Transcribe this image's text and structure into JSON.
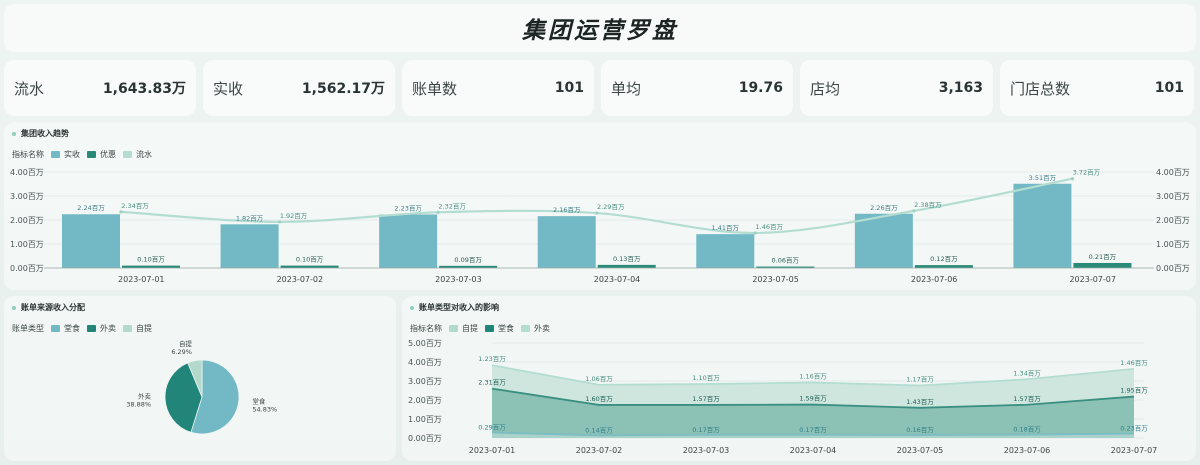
{
  "title": "集团运营罗盘",
  "kpis": [
    {
      "label": "流水",
      "value": "1,643.83万"
    },
    {
      "label": "实收",
      "value": "1,562.17万"
    },
    {
      "label": "账单数",
      "value": "101"
    },
    {
      "label": "单均",
      "value": "19.76"
    },
    {
      "label": "店均",
      "value": "3,163"
    },
    {
      "label": "门店总数",
      "value": "101"
    }
  ],
  "colors": {
    "shishou": "#72b9c5",
    "youhui": "#2a8a78",
    "liushui": "#b4ddd2",
    "tangshi": "#72b9c5",
    "waimai": "#22857a",
    "ziti": "#b2d9cc"
  },
  "trend": {
    "title": "集团收入趋势",
    "legend_label": "指标名称",
    "legend": [
      "实收",
      "优惠",
      "流水"
    ],
    "y_ticks": [
      "4.00百万",
      "3.00百万",
      "2.00百万",
      "1.00百万",
      "0.00百万"
    ],
    "y_ticks_right": [
      "4.00百万",
      "3.00百万",
      "2.00百万",
      "1.00百万",
      "0.00百万"
    ]
  },
  "pie": {
    "title": "账单来源收入分配",
    "legend_label": "账单类型",
    "legend": [
      "堂食",
      "外卖",
      "自提"
    ],
    "labels": [
      {
        "name": "堂食",
        "pct": "54.83%"
      },
      {
        "name": "外卖",
        "pct": "38.88%"
      },
      {
        "name": "自提",
        "pct": "6.29%"
      }
    ]
  },
  "area": {
    "title": "账单类型对收入的影响",
    "legend_label": "指标名称",
    "legend": [
      "自提",
      "堂食",
      "外卖"
    ],
    "y_ticks": [
      "5.00百万",
      "4.00百万",
      "3.00百万",
      "2.00百万",
      "1.00百万",
      "0.00百万"
    ]
  },
  "chart_data": [
    {
      "type": "bar",
      "title": "集团收入趋势",
      "categories": [
        "2023-07-01",
        "2023-07-02",
        "2023-07-03",
        "2023-07-04",
        "2023-07-05",
        "2023-07-06",
        "2023-07-07"
      ],
      "series": [
        {
          "name": "实收",
          "values": [
            2.24,
            1.82,
            2.23,
            2.16,
            1.41,
            2.26,
            3.51
          ],
          "labels": [
            "2.24百万",
            "1.82百万",
            "2.23百万",
            "2.16百万",
            "1.41百万",
            "2.26百万",
            "3.51百万"
          ]
        },
        {
          "name": "优惠",
          "values": [
            0.1,
            0.1,
            0.09,
            0.13,
            0.06,
            0.12,
            0.21
          ],
          "labels": [
            "0.10百万",
            "0.10百万",
            "0.09百万",
            "0.13百万",
            "0.06百万",
            "0.12百万",
            "0.21百万"
          ]
        },
        {
          "name": "流水",
          "type": "line",
          "values": [
            2.34,
            1.92,
            2.32,
            2.29,
            1.46,
            2.38,
            3.72
          ],
          "labels": [
            "2.34百万",
            "1.92百万",
            "2.32百万",
            "2.29百万",
            "1.46百万",
            "2.38百万",
            "3.72百万"
          ]
        }
      ],
      "ylim": [
        0,
        4
      ]
    },
    {
      "type": "pie",
      "title": "账单来源收入分配",
      "categories": [
        "堂食",
        "外卖",
        "自提"
      ],
      "values": [
        54.83,
        38.88,
        6.29
      ]
    },
    {
      "type": "area",
      "title": "账单类型对收入的影响",
      "categories": [
        "2023-07-01",
        "2023-07-02",
        "2023-07-03",
        "2023-07-04",
        "2023-07-05",
        "2023-07-06",
        "2023-07-07"
      ],
      "series": [
        {
          "name": "自提",
          "values": [
            0.29,
            0.14,
            0.17,
            0.17,
            0.16,
            0.18,
            0.23
          ],
          "labels": [
            "0.29百万",
            "0.14百万",
            "0.17百万",
            "0.17百万",
            "0.16百万",
            "0.18百万",
            "0.23百万"
          ]
        },
        {
          "name": "堂食",
          "values": [
            2.31,
            1.6,
            1.57,
            1.59,
            1.43,
            1.57,
            1.95
          ],
          "labels": [
            "2.31百万",
            "1.60百万",
            "1.57百万",
            "1.59百万",
            "1.43百万",
            "1.57百万",
            "1.95百万"
          ]
        },
        {
          "name": "外卖",
          "values": [
            1.23,
            1.06,
            1.1,
            1.16,
            1.17,
            1.34,
            1.46
          ],
          "labels": [
            "1.23百万",
            "1.06百万",
            "1.10百万",
            "1.16百万",
            "1.17百万",
            "1.34百万",
            "1.46百万"
          ]
        }
      ],
      "stacked": true,
      "ylim": [
        0,
        5
      ]
    }
  ]
}
